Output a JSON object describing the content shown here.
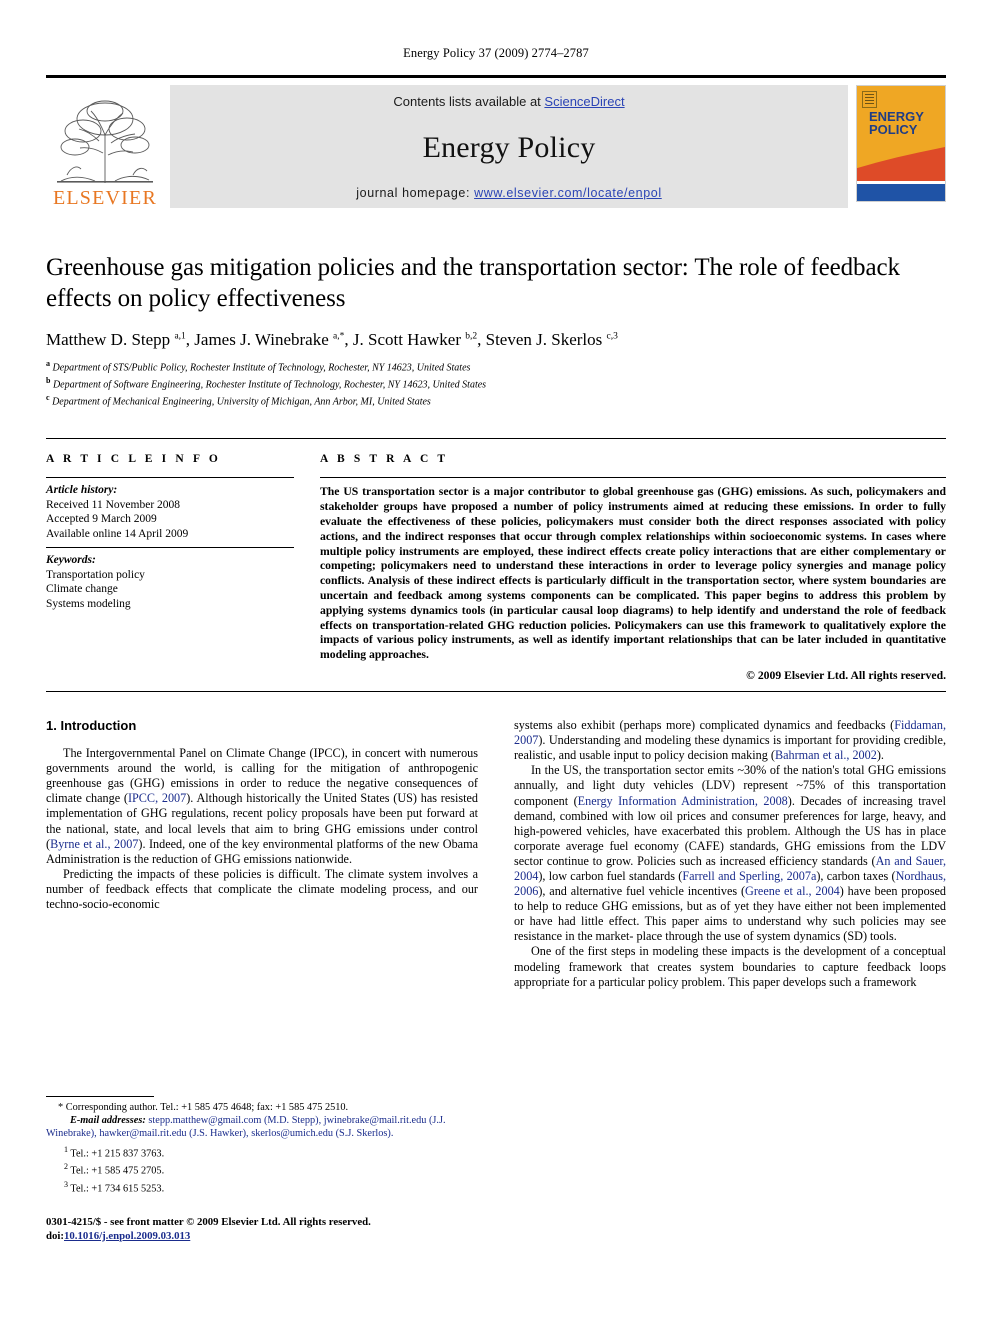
{
  "running_head": "Energy Policy 37 (2009) 2774–2787",
  "masthead": {
    "publisher_name": "ELSEVIER",
    "contents_prefix": "Contents lists available at ",
    "contents_link": "ScienceDirect",
    "journal_name": "Energy Policy",
    "homepage_prefix": "journal homepage: ",
    "homepage_url": "www.elsevier.com/locate/enpol",
    "cover_title_line1": "ENERGY",
    "cover_title_line2": "POLICY",
    "colors": {
      "elsevier_orange": "#E87722",
      "link_blue": "#2b44b5",
      "cover_amber": "#EFA724",
      "cover_red": "#DE4B28",
      "cover_blue": "#1F53A6",
      "band_gray": "#e3e3e3"
    }
  },
  "article": {
    "title": "Greenhouse gas mitigation policies and the transportation sector: The role of feedback effects on policy effectiveness",
    "authors_html": "Matthew D. Stepp <sup>a,1</sup>, James J. Winebrake <sup>a,*</sup>, J. Scott Hawker <sup>b,2</sup>, Steven J. Skerlos <sup>c,3</sup>",
    "affiliations": [
      {
        "marker": "a",
        "text": "Department of STS/Public Policy, Rochester Institute of Technology, Rochester, NY 14623, United States"
      },
      {
        "marker": "b",
        "text": "Department of Software Engineering, Rochester Institute of Technology, Rochester, NY 14623, United States"
      },
      {
        "marker": "c",
        "text": "Department of Mechanical Engineering, University of Michigan, Ann Arbor, MI, United States"
      }
    ]
  },
  "article_info": {
    "heading": "A R T I C L E  I N F O",
    "history_label": "Article history:",
    "history": [
      "Received 11 November 2008",
      "Accepted 9 March 2009",
      "Available online 14 April 2009"
    ],
    "keywords_label": "Keywords:",
    "keywords": [
      "Transportation policy",
      "Climate change",
      "Systems modeling"
    ]
  },
  "abstract": {
    "heading": "A B S T R A C T",
    "text": "The US transportation sector is a major contributor to global greenhouse gas (GHG) emissions. As such, policymakers and stakeholder groups have proposed a number of policy instruments aimed at reducing these emissions. In order to fully evaluate the effectiveness of these policies, policymakers must consider both the direct responses associated with policy actions, and the indirect responses that occur through complex relationships within socioeconomic systems. In cases where multiple policy instruments are employed, these indirect effects create policy interactions that are either complementary or competing; policymakers need to understand these interactions in order to leverage policy synergies and manage policy conflicts. Analysis of these indirect effects is particularly difficult in the transportation sector, where system boundaries are uncertain and feedback among systems components can be complicated. This paper begins to address this problem by applying systems dynamics tools (in particular causal loop diagrams) to help identify and understand the role of feedback effects on transportation-related GHG reduction policies. Policymakers can use this framework to qualitatively explore the impacts of various policy instruments, as well as identify important relationships that can be later included in quantitative modeling approaches.",
    "copyright": "© 2009 Elsevier Ltd. All rights reserved."
  },
  "introduction": {
    "heading": "1.  Introduction",
    "left_paragraphs": [
      "The Intergovernmental Panel on Climate Change (IPCC), in concert with numerous governments around the world, is calling for the mitigation of anthropogenic greenhouse gas (GHG) emissions in order to reduce the negative consequences of climate change (IPCC, 2007). Although historically the United States (US) has resisted implementation of GHG regulations, recent policy proposals have been put forward at the national, state, and local levels that aim to bring GHG emissions under control (Byrne et al., 2007). Indeed, one of the key environmental platforms of the new Obama Administration is the reduction of GHG emissions nationwide.",
      "Predicting the impacts of these policies is difficult. The climate system involves a number of feedback effects that complicate the climate modeling process, and our techno-socio-economic"
    ],
    "right_paragraphs": [
      "systems also exhibit (perhaps more) complicated dynamics and feedbacks (Fiddaman, 2007). Understanding and modeling these dynamics is important for providing credible, realistic, and usable input to policy decision making (Bahrman et al., 2002).",
      "In the US, the transportation sector emits ~30% of the nation's total GHG emissions annually, and light duty vehicles (LDV) represent ~75% of this transportation component (Energy Information Administration, 2008). Decades of increasing travel demand, combined with low oil prices and consumer preferences for large, heavy, and high-powered vehicles, have exacerbated this problem. Although the US has in place corporate average fuel economy (CAFE) standards, GHG emissions from the LDV sector continue to grow. Policies such as increased efficiency standards (An and Sauer, 2004), low carbon fuel standards (Farrell and Sperling, 2007a), carbon taxes (Nordhaus, 2006), and alternative fuel vehicle incentives (Greene et al., 2004) have been proposed to help to reduce GHG emissions, but as of yet they have either not been implemented or have had little effect. This paper aims to understand why such policies may see resistance in the marketplace through the use of system dynamics (SD) tools.",
      "One of the first steps in modeling these impacts is the development of a conceptual modeling framework that creates system boundaries to capture feedback loops appropriate for a particular policy problem. This paper develops such a framework"
    ],
    "citation_links": [
      "IPCC, 2007",
      "Byrne et al., 2007",
      "Fiddaman, 2007",
      "Bahrman et al., 2002",
      "Energy Information Administration, 2008",
      "An and Sauer, 2004",
      "Farrell and Sperling, 2007a",
      "Nordhaus, 2006",
      "Greene et al., 2004"
    ]
  },
  "footnotes": {
    "corresponding": "* Corresponding author. Tel.: +1 585 475 4648; fax: +1 585 475 2510.",
    "email_label": "E-mail addresses:",
    "emails": "stepp.matthew@gmail.com (M.D. Stepp), jwinebrake@mail.rit.edu (J.J. Winebrake), hawker@mail.rit.edu (J.S. Hawker), skerlos@umich.edu (S.J. Skerlos).",
    "tels": [
      {
        "marker": "1",
        "text": "Tel.: +1 215 837 3763."
      },
      {
        "marker": "2",
        "text": "Tel.: +1 585 475 2705."
      },
      {
        "marker": "3",
        "text": "Tel.: +1 734 615 5253."
      }
    ]
  },
  "imprint": {
    "issn_line": "0301-4215/$ - see front matter © 2009 Elsevier Ltd. All rights reserved.",
    "doi_label": "doi:",
    "doi_value": "10.1016/j.enpol.2009.03.013"
  }
}
